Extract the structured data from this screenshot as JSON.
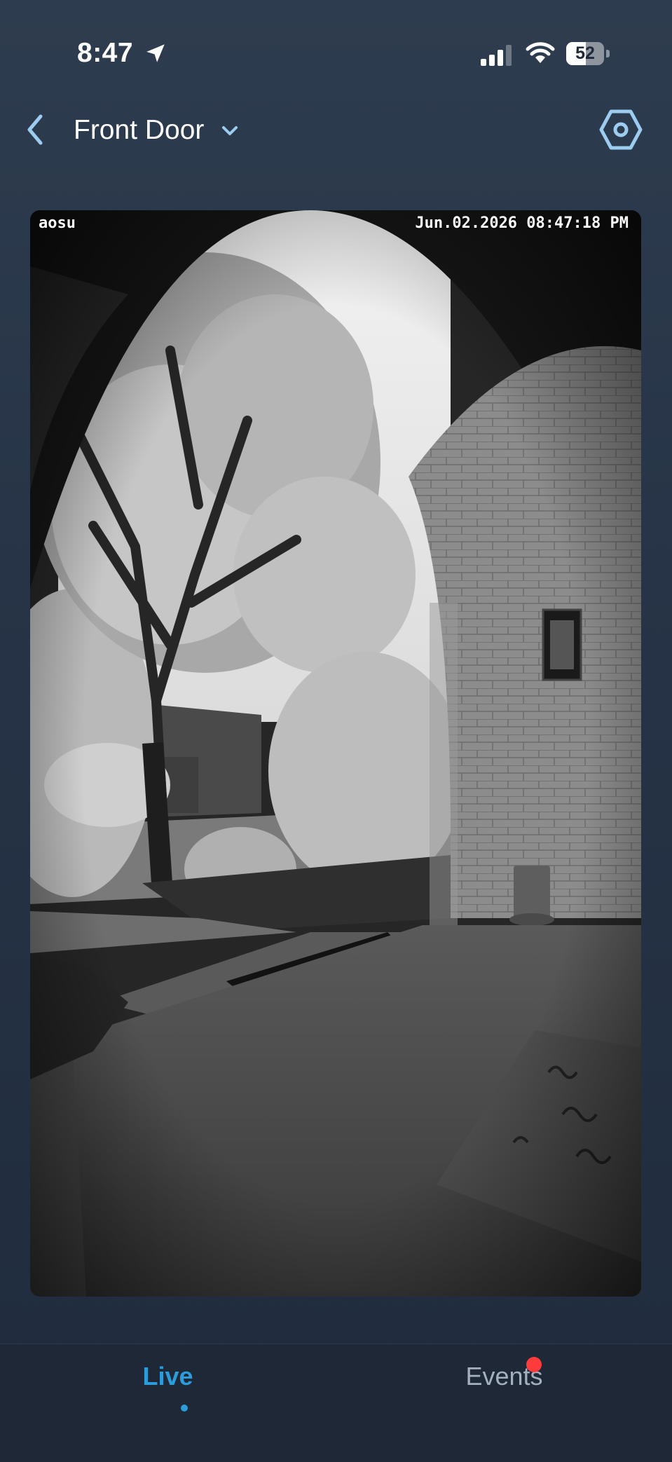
{
  "status_bar": {
    "time": "8:47",
    "battery_level": "52",
    "battery_fraction": 0.52,
    "icons": [
      "location-arrow-icon",
      "cellular-signal-icon",
      "wifi-icon",
      "battery-icon"
    ]
  },
  "header": {
    "title": "Front Door",
    "back_icon": "chevron-left-icon",
    "dropdown_icon": "chevron-down-icon",
    "settings_icon": "hexagon-gear-icon"
  },
  "camera_feed": {
    "brand": "aosu",
    "timestamp": "Jun.02.2026 08:47:18 PM"
  },
  "tab_bar": {
    "tabs": [
      {
        "label": "Live",
        "active": true
      },
      {
        "label": "Events",
        "active": false,
        "has_notification": true
      }
    ]
  },
  "colors": {
    "background": "#263346",
    "tab_bar_background": "#1e2837",
    "accent": "#2d9cdb",
    "icon_light_blue": "#9ccdf0",
    "notification_red": "#ff3b3b",
    "inactive_text": "#a5b0bf"
  }
}
